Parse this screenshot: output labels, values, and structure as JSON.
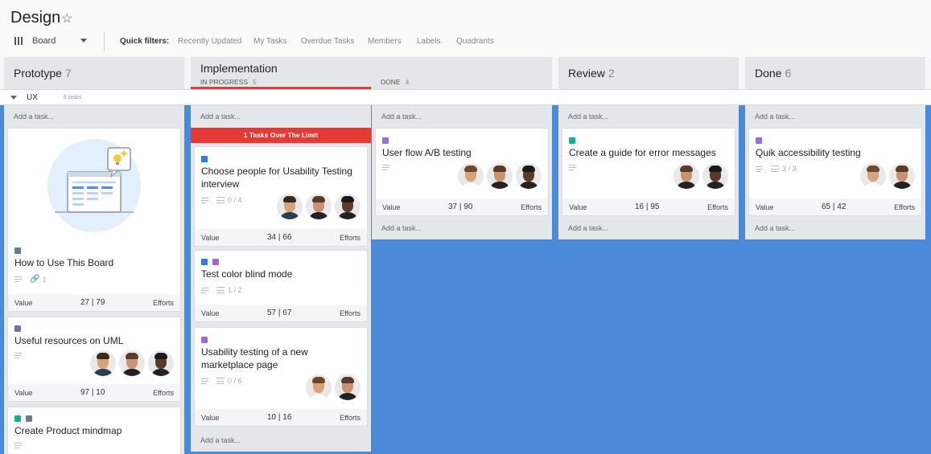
{
  "header": {
    "title": "Design",
    "view": "Board",
    "quick_filters_label": "Quick filters:",
    "filters": [
      "Recently Updated",
      "My Tasks",
      "Overdue Tasks",
      "Members",
      "Labels",
      "Quadrants"
    ]
  },
  "columns": [
    {
      "name": "Prototype",
      "count": "7"
    },
    {
      "name": "Implementation",
      "in_progress": "IN PROGRESS",
      "in_progress_count": "5",
      "done": "DONE",
      "done_count": "4"
    },
    {
      "name": "Review",
      "count": "2"
    },
    {
      "name": "Done",
      "count": "6"
    }
  ],
  "swimlane": {
    "label": "UX",
    "count": "8 tasks"
  },
  "add_task": "Add a task...",
  "limit_banner": "1 Tasks Over The Limit",
  "value_label": "Value",
  "efforts_label": "Efforts",
  "cards": {
    "how_to": {
      "title": "How to Use This Board",
      "attachments": "1",
      "value": "27 | 79"
    },
    "uml": {
      "title": "Useful resources on UML",
      "value": "97 | 10"
    },
    "mindmap": {
      "title": "Create Product mindmap"
    },
    "choose": {
      "title": "Choose people for Usability Testing interview",
      "checklist": "0 / 4",
      "value": "34 | 66"
    },
    "colorblind": {
      "title": "Test color blind mode",
      "checklist": "1 / 2",
      "value": "57 | 67"
    },
    "marketplace": {
      "title": "Usability testing of a new marketplace page",
      "checklist": "0 / 6",
      "value": "10 | 16"
    },
    "abtest": {
      "title": "User flow A/B testing",
      "value": "37 | 90"
    },
    "errorguide": {
      "title": "Create a guide for error messages",
      "value": "16 | 95"
    },
    "access": {
      "title": "Quik accessibility testing",
      "checklist": "3 / 3",
      "value": "65 | 42"
    }
  },
  "colors": {
    "blue": "#4a8ad8",
    "red": "#e53935",
    "tag_gray": "#6f7a90",
    "tag_blue": "#2b7de0",
    "tag_purple": "#9c6bd8",
    "tag_teal": "#14b08f"
  },
  "icons": [
    "star-icon",
    "board-icon",
    "chevron-down-icon",
    "lightbulb-icon",
    "description-icon",
    "checklist-icon",
    "attachment-icon"
  ]
}
